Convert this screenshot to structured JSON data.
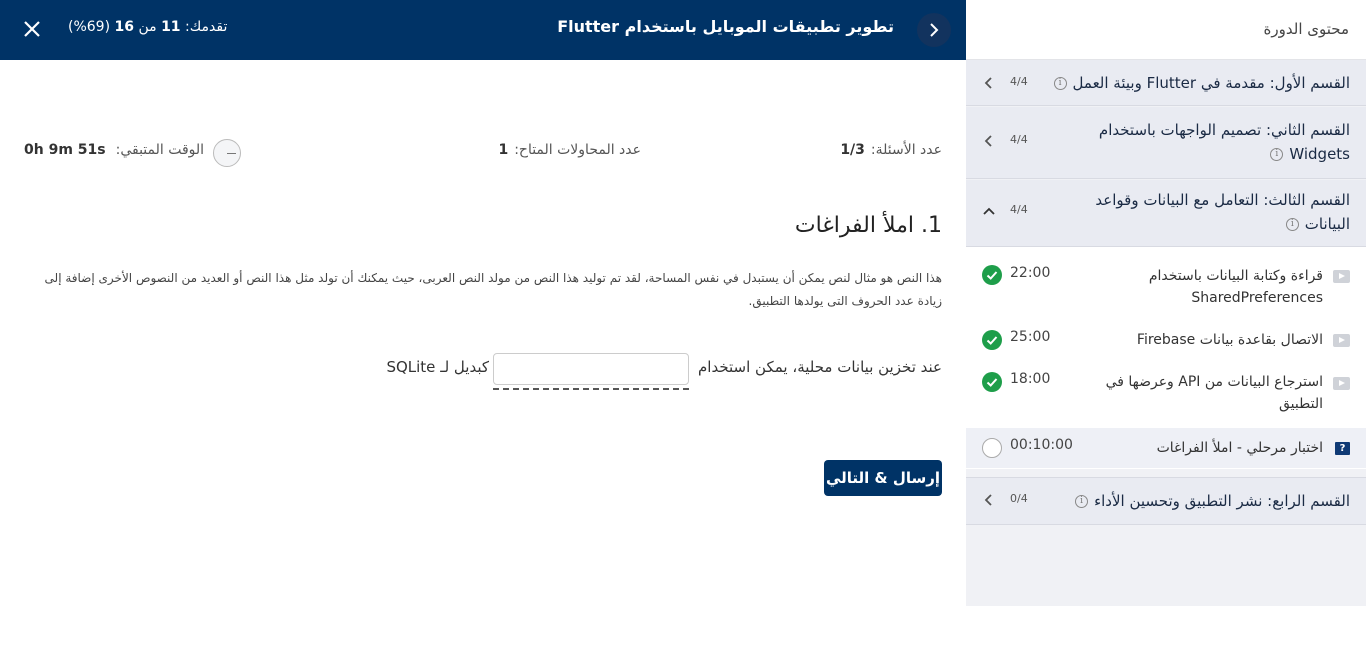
{
  "header": {
    "progress_label": "تقدمك:",
    "progress_done": "11",
    "progress_of": "من",
    "progress_total": "16",
    "progress_percent": "(69%)",
    "course_title": "تطوير تطبيقات الموبايل باستخدام Flutter"
  },
  "sidebar": {
    "title": "محتوى الدورة",
    "sections": [
      {
        "title": "القسم الأول: مقدمة في Flutter وبيئة العمل",
        "count": "4/4"
      },
      {
        "title_line1": "القسم الثاني: تصميم الواجهات باستخدام",
        "title_line2": "Widgets",
        "count": "4/4"
      },
      {
        "title_line1": "القسم الثالث: التعامل مع البيانات وقواعد",
        "title_line2": "البيانات",
        "count": "4/4"
      },
      {
        "title": "القسم الرابع: نشر التطبيق وتحسين الأداء",
        "count": "0/4"
      }
    ],
    "lessons": [
      {
        "title_line1": "قراءة وكتابة البيانات باستخدام",
        "title_line2": "SharedPreferences",
        "time": "22:00",
        "done": true
      },
      {
        "title": "الاتصال بقاعدة بيانات Firebase",
        "time": "25:00",
        "done": true
      },
      {
        "title_line1": "استرجاع البيانات من API وعرضها في",
        "title_line2": "التطبيق",
        "time": "18:00",
        "done": true
      },
      {
        "title": "اختبار مرحلي - املأ الفراغات",
        "time": "00:10:00",
        "done": false
      }
    ]
  },
  "quiz": {
    "questions_label": "عدد الأسئلة:",
    "questions_value": "1/3",
    "attempts_label": "عدد المحاولات المتاح:",
    "attempts_value": "1",
    "time_label": "الوقت المتبقي:",
    "time_value": "0h 9m 51s",
    "question_title": "1. املأ الفراغات",
    "description": "هذا النص هو مثال لنص يمكن أن يستبدل في نفس المساحة، لقد تم توليد هذا النص من مولد النص العربى، حيث يمكنك أن تولد مثل هذا النص أو العديد من النصوص الأخرى إضافة إلى زيادة عدد الحروف التى يولدها التطبيق.",
    "fill_before": "عند تخزين بيانات محلية، يمكن استخدام",
    "fill_after": "كبديل لـ SQLite",
    "fill_value": "",
    "submit_label": "إرسال & التالي"
  },
  "colors": {
    "primary": "#003366",
    "success": "#1e9e4a",
    "sidebar_bg": "#f0f1f5"
  }
}
